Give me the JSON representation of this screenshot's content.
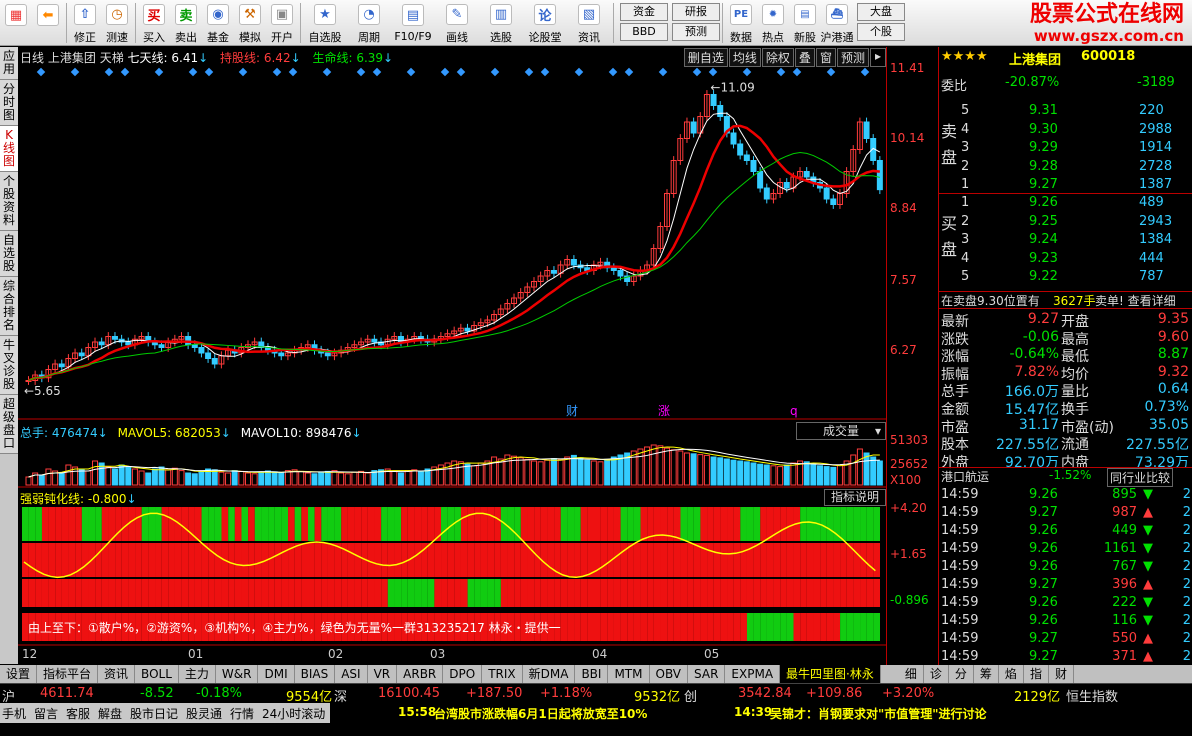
{
  "toolbar": {
    "buttons": [
      {
        "label": "",
        "icon": "grid-icon"
      },
      {
        "label": "",
        "icon": "back-arrow-icon"
      },
      {
        "label": "修正",
        "icon": "up-arrow-icon"
      },
      {
        "label": "测速",
        "icon": "clock-icon"
      },
      {
        "label": "买入",
        "icon": "buy-icon"
      },
      {
        "label": "卖出",
        "icon": "sell-icon"
      },
      {
        "label": "基金",
        "icon": "fund-icon"
      },
      {
        "label": "模拟",
        "icon": "hammer-icon"
      },
      {
        "label": "开户",
        "icon": "lock-icon"
      },
      {
        "label": "自选股",
        "icon": "star-icon"
      },
      {
        "label": "周期",
        "icon": "cycle-icon"
      },
      {
        "label": "F10/F9",
        "icon": "f10-icon"
      },
      {
        "label": "画线",
        "icon": "pen-icon"
      },
      {
        "label": "选股",
        "icon": "select-icon"
      },
      {
        "label": "论股堂",
        "icon": "forum-icon"
      },
      {
        "label": "资讯",
        "icon": "news-icon"
      }
    ],
    "btn_pairs": [
      [
        "资金",
        "BBD"
      ],
      [
        "研报",
        "预测"
      ]
    ],
    "buttons2": [
      {
        "label": "数据",
        "icon": "pe-icon"
      },
      {
        "label": "热点",
        "icon": "hot-icon"
      },
      {
        "label": "新股",
        "icon": "newstock-icon"
      },
      {
        "label": "沪港通",
        "icon": "hk-icon"
      }
    ],
    "btn_dapan": [
      "大盘",
      "个股"
    ],
    "logo_cn": "股票公式在线网",
    "logo_url": "www.gszx.com.cn"
  },
  "left_tabs": [
    "应用",
    "分时图",
    "K线图",
    "个股资料",
    "自选股",
    "综合排名",
    "牛叉诊股",
    "超级盘口"
  ],
  "chart_header": {
    "period": "日线",
    "stock": "上港集团",
    "ladder": "天梯",
    "seven": "七天线: 6.41",
    "hold": "持股线: 6.42",
    "life": "生命线: 6.39"
  },
  "chart_buttons": [
    "删自选",
    "均线",
    "除权",
    "叠",
    "窗",
    "预测"
  ],
  "price_axis": [
    "11.41",
    "10.14",
    "8.84",
    "7.57",
    "6.27"
  ],
  "marks": {
    "high": "11.09",
    "low": "5.65",
    "fin": "财",
    "up": "涨",
    "q": "q"
  },
  "volume": {
    "label": "总手: 476474",
    "ma5": "MAVOL5: 682053",
    "ma10": "MAVOL10: 898476",
    "select": "成交量",
    "axis": [
      "51303",
      "25652",
      "X100"
    ]
  },
  "indicator": {
    "label": "强弱钝化线: -0.800",
    "button": "指标说明",
    "axis": [
      "+4.20",
      "+1.65",
      "-0.896"
    ],
    "note": "由上至下：①散户%，②游资%，③机构%，④主力%，绿色为无量%一群313235217 林永・提供一"
  },
  "x_labels": [
    "12",
    "01",
    "02",
    "03",
    "04",
    "05"
  ],
  "bottom_tabs": [
    "设置",
    "指标平台",
    "资讯",
    "BOLL",
    "主力",
    "W&R",
    "DMI",
    "BIAS",
    "ASI",
    "VR",
    "ARBR",
    "DPO",
    "TRIX",
    "新DMA",
    "BBI",
    "MTM",
    "OBV",
    "SAR",
    "EXPMA",
    "最牛四里图·林永",
    "细",
    "诊",
    "分",
    "筹",
    "焰",
    "指",
    "财"
  ],
  "quote": {
    "name": "上港集团",
    "code": "600018",
    "weibi_label": "委比",
    "weibi": "-20.87%",
    "weicha": "-3189",
    "sell_label": [
      "卖",
      "盘"
    ],
    "buy_label": [
      "买",
      "盘"
    ],
    "sell": [
      {
        "n": "5",
        "p": "9.31",
        "v": "220"
      },
      {
        "n": "4",
        "p": "9.30",
        "v": "2988"
      },
      {
        "n": "3",
        "p": "9.29",
        "v": "1914"
      },
      {
        "n": "2",
        "p": "9.28",
        "v": "2728"
      },
      {
        "n": "1",
        "p": "9.27",
        "v": "1387"
      }
    ],
    "buy": [
      {
        "n": "1",
        "p": "9.26",
        "v": "489"
      },
      {
        "n": "2",
        "p": "9.25",
        "v": "2943"
      },
      {
        "n": "3",
        "p": "9.24",
        "v": "1384"
      },
      {
        "n": "4",
        "p": "9.23",
        "v": "444"
      },
      {
        "n": "5",
        "p": "9.22",
        "p2": "",
        "v": "787"
      }
    ],
    "notice": "在卖盘9.30位置有",
    "notice_v": "3627手",
    "notice_b": "卖单! 查看详细",
    "stats": [
      [
        "最新",
        "9.27",
        "开盘",
        "9.35"
      ],
      [
        "涨跌",
        "-0.06",
        "最高",
        "9.60"
      ],
      [
        "涨幅",
        "-0.64%",
        "最低",
        "8.87"
      ],
      [
        "振幅",
        "7.82%",
        "均价",
        "9.32"
      ],
      [
        "总手",
        "166.0万",
        "量比",
        "0.64"
      ],
      [
        "金额",
        "15.47亿",
        "换手",
        "0.73%"
      ],
      [
        "市盈",
        "31.17",
        "市盈(动)",
        "35.05"
      ],
      [
        "股本",
        "227.55亿",
        "流通",
        "227.55亿"
      ],
      [
        "外盘",
        "92.70万",
        "内盘",
        "73.29万"
      ]
    ],
    "sector": "港口航运",
    "sector_pct": "-1.52%",
    "compare": "同行业比较",
    "ticks": [
      {
        "t": "14:59",
        "p": "9.26",
        "v": "895",
        "d": "down"
      },
      {
        "t": "14:59",
        "p": "9.27",
        "v": "987",
        "d": "up"
      },
      {
        "t": "14:59",
        "p": "9.26",
        "v": "449",
        "d": "down"
      },
      {
        "t": "14:59",
        "p": "9.26",
        "v": "1161",
        "d": "down"
      },
      {
        "t": "14:59",
        "p": "9.26",
        "v": "767",
        "d": "down"
      },
      {
        "t": "14:59",
        "p": "9.27",
        "v": "396",
        "d": "up"
      },
      {
        "t": "14:59",
        "p": "9.26",
        "v": "222",
        "d": "down"
      },
      {
        "t": "14:59",
        "p": "9.26",
        "v": "116",
        "d": "down"
      },
      {
        "t": "14:59",
        "p": "9.27",
        "v": "550",
        "d": "up"
      },
      {
        "t": "14:59",
        "p": "9.27",
        "v": "371",
        "d": "up"
      }
    ],
    "tick_tail": "2"
  },
  "index_bar": {
    "sh": "沪",
    "sh_v": "4611.74",
    "sh_c": "-8.52",
    "sh_p": "-0.18%",
    "sh_a": "9554亿",
    "sz": "深",
    "sz_v": "16100.45",
    "sz_c": "+187.50",
    "sz_p": "+1.18%",
    "sz_a": "9532亿",
    "cy": "创",
    "cy_v": "3542.84",
    "cy_c": "+109.86",
    "cy_p": "+3.20%",
    "hs_a": "2129亿",
    "hs": "恒生指数"
  },
  "status": [
    "手机",
    "留言",
    "客服",
    "解盘",
    "股市日记",
    "股灵通",
    "行情",
    "24小时滚动"
  ],
  "news": [
    {
      "time": "15:58",
      "text": "台湾股市涨跌幅6月1日起将放宽至10%"
    },
    {
      "time": "14:39",
      "text": "吴锦才：肖钢要求对\"市值管理\"进行讨论"
    }
  ],
  "chart_data": {
    "type": "candlestick",
    "x_ticks": [
      "12",
      "01",
      "02",
      "03",
      "04",
      "05"
    ],
    "ylim": [
      5.5,
      11.5
    ],
    "price_ticks": [
      11.41,
      10.14,
      8.84,
      7.57,
      6.27
    ],
    "high_mark": 11.09,
    "low_mark": 5.65,
    "close": [
      5.8,
      5.9,
      5.85,
      6.0,
      6.1,
      6.05,
      6.2,
      6.3,
      6.25,
      6.4,
      6.5,
      6.45,
      6.6,
      6.55,
      6.5,
      6.45,
      6.55,
      6.6,
      6.5,
      6.45,
      6.4,
      6.5,
      6.55,
      6.6,
      6.45,
      6.4,
      6.3,
      6.2,
      6.1,
      6.25,
      6.35,
      6.3,
      6.4,
      6.45,
      6.5,
      6.4,
      6.35,
      6.3,
      6.25,
      6.3,
      6.35,
      6.4,
      6.45,
      6.35,
      6.3,
      6.25,
      6.3,
      6.35,
      6.4,
      6.45,
      6.5,
      6.55,
      6.5,
      6.45,
      6.55,
      6.6,
      6.5,
      6.55,
      6.6,
      6.55,
      6.5,
      6.55,
      6.6,
      6.65,
      6.7,
      6.75,
      6.7,
      6.8,
      6.85,
      6.9,
      7.0,
      7.1,
      7.2,
      7.3,
      7.4,
      7.5,
      7.6,
      7.7,
      7.8,
      7.75,
      7.9,
      8.0,
      7.9,
      7.85,
      7.8,
      7.9,
      7.95,
      7.85,
      7.8,
      7.7,
      7.6,
      7.7,
      7.8,
      7.9,
      8.2,
      8.6,
      9.2,
      9.8,
      10.2,
      10.5,
      10.3,
      10.6,
      11.0,
      10.8,
      10.6,
      10.3,
      10.1,
      9.9,
      9.8,
      9.6,
      9.3,
      9.1,
      9.2,
      9.4,
      9.3,
      9.5,
      9.6,
      9.5,
      9.4,
      9.3,
      9.1,
      9.0,
      9.2,
      9.6,
      10.0,
      10.5,
      10.2,
      9.8,
      9.27
    ],
    "volume": [
      20,
      30,
      25,
      40,
      35,
      30,
      50,
      45,
      40,
      35,
      60,
      55,
      45,
      40,
      50,
      45,
      40,
      35,
      30,
      40,
      45,
      38,
      42,
      36,
      30,
      28,
      35,
      40,
      38,
      32,
      30,
      36,
      34,
      30,
      28,
      32,
      35,
      33,
      30,
      36,
      38,
      34,
      30,
      28,
      32,
      34,
      36,
      30,
      28,
      32,
      34,
      30,
      36,
      38,
      40,
      35,
      30,
      36,
      38,
      34,
      40,
      45,
      50,
      55,
      60,
      58,
      52,
      48,
      55,
      60,
      70,
      65,
      75,
      72,
      68,
      64,
      60,
      58,
      62,
      66,
      64,
      70,
      74,
      68,
      62,
      60,
      58,
      64,
      70,
      75,
      80,
      85,
      90,
      95,
      100,
      98,
      92,
      88,
      85,
      80,
      78,
      76,
      74,
      70,
      68,
      65,
      62,
      60,
      58,
      55,
      52,
      50,
      48,
      46,
      50,
      55,
      60,
      58,
      52,
      48,
      46,
      44,
      50,
      60,
      75,
      90,
      80,
      70,
      60
    ]
  }
}
